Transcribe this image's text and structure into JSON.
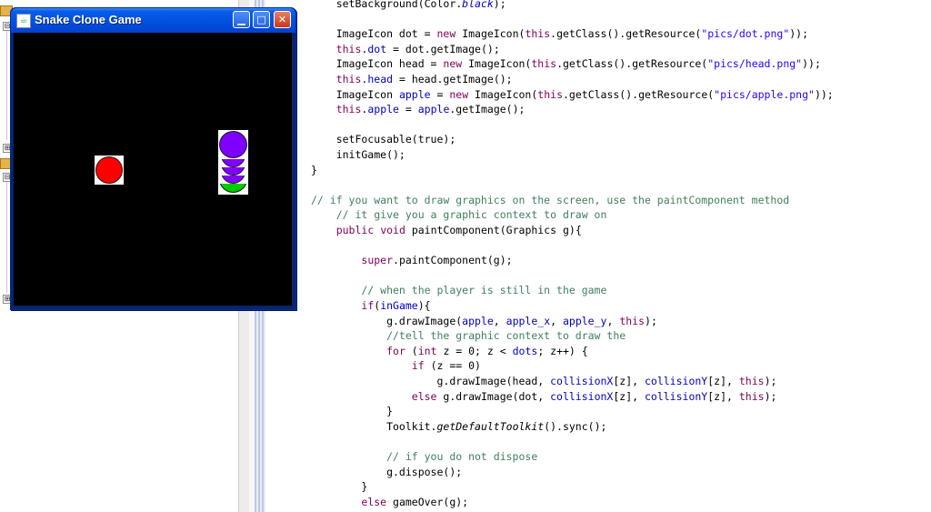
{
  "window": {
    "title": "Snake Clone Game",
    "icon": "java-app-icon",
    "controls": {
      "minimize": "minimize-icon",
      "maximize": "maximize-icon",
      "close": "close-icon"
    }
  },
  "game": {
    "background_color": "#000000",
    "apple_color": "#ff0000",
    "snake_head_color": "#8000ff",
    "snake_body_color": "#8000ff",
    "snake_tail_color": "#00cc00"
  },
  "tree": {
    "toggles": [
      "⊟",
      "⊞",
      "⊟",
      "⊞"
    ]
  },
  "code": {
    "lines": [
      "    setBackground(Color.black);",
      "",
      "    ImageIcon dot = new ImageIcon(this.getClass().getResource(\"pics/dot.png\"));",
      "    this.dot = dot.getImage();",
      "    ImageIcon head = new ImageIcon(this.getClass().getResource(\"pics/head.png\"));",
      "    this.head = head.getImage();",
      "    ImageIcon apple = new ImageIcon(this.getClass().getResource(\"pics/apple.png\"));",
      "    this.apple = apple.getImage();",
      "",
      "    setFocusable(true);",
      "    initGame();",
      "}",
      "",
      "// if you want to draw graphics on the screen, use the paintComponent method",
      "    // it give you a graphic context to draw on",
      "    public void paintComponent(Graphics g){",
      "",
      "        super.paintComponent(g);",
      "",
      "        // when the player is still in the game",
      "        if(inGame){",
      "            g.drawImage(apple, apple_x, apple_y, this);",
      "            //tell the graphic context to draw the",
      "            for (int z = 0; z < dots; z++) {",
      "                if (z == 0)",
      "                    g.drawImage(head, collisionX[z], collisionY[z], this);",
      "                else g.drawImage(dot, collisionX[z], collisionY[z], this);",
      "            }",
      "            Toolkit.getDefaultToolkit().sync();",
      "",
      "            // if you do not dispose",
      "            g.dispose();",
      "        }",
      "        else gameOver(g);"
    ]
  }
}
